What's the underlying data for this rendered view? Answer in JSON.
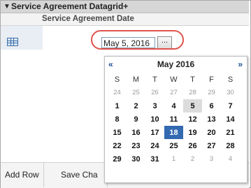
{
  "panel": {
    "title": "Service Agreement Datagrid+"
  },
  "grid": {
    "column_header": "Service Agreement Date"
  },
  "date_field": {
    "value": "May 5, 2016",
    "button_label": "..."
  },
  "toolbar": {
    "add_row": "Add Row",
    "save_changes": "Save Cha"
  },
  "calendar": {
    "prev": "«",
    "next": "»",
    "month_label": "May 2016",
    "weekdays": [
      "S",
      "M",
      "T",
      "W",
      "T",
      "F",
      "S"
    ],
    "weeks": [
      [
        {
          "d": "24",
          "m": "other"
        },
        {
          "d": "25",
          "m": "other"
        },
        {
          "d": "26",
          "m": "other"
        },
        {
          "d": "27",
          "m": "other"
        },
        {
          "d": "28",
          "m": "other"
        },
        {
          "d": "29",
          "m": "other"
        },
        {
          "d": "30",
          "m": "other"
        }
      ],
      [
        {
          "d": "1",
          "m": "cur"
        },
        {
          "d": "2",
          "m": "cur"
        },
        {
          "d": "3",
          "m": "cur"
        },
        {
          "d": "4",
          "m": "cur"
        },
        {
          "d": "5",
          "m": "hover"
        },
        {
          "d": "6",
          "m": "cur"
        },
        {
          "d": "7",
          "m": "cur"
        }
      ],
      [
        {
          "d": "8",
          "m": "cur"
        },
        {
          "d": "9",
          "m": "cur"
        },
        {
          "d": "10",
          "m": "cur"
        },
        {
          "d": "11",
          "m": "cur"
        },
        {
          "d": "12",
          "m": "cur"
        },
        {
          "d": "13",
          "m": "cur"
        },
        {
          "d": "14",
          "m": "cur"
        }
      ],
      [
        {
          "d": "15",
          "m": "cur"
        },
        {
          "d": "16",
          "m": "cur"
        },
        {
          "d": "17",
          "m": "cur"
        },
        {
          "d": "18",
          "m": "sel"
        },
        {
          "d": "19",
          "m": "cur"
        },
        {
          "d": "20",
          "m": "cur"
        },
        {
          "d": "21",
          "m": "cur"
        }
      ],
      [
        {
          "d": "22",
          "m": "cur"
        },
        {
          "d": "23",
          "m": "cur"
        },
        {
          "d": "24",
          "m": "cur"
        },
        {
          "d": "25",
          "m": "cur"
        },
        {
          "d": "26",
          "m": "cur"
        },
        {
          "d": "27",
          "m": "cur"
        },
        {
          "d": "28",
          "m": "cur"
        }
      ],
      [
        {
          "d": "29",
          "m": "cur"
        },
        {
          "d": "30",
          "m": "cur"
        },
        {
          "d": "31",
          "m": "cur"
        },
        {
          "d": "1",
          "m": "other"
        },
        {
          "d": "2",
          "m": "other"
        },
        {
          "d": "3",
          "m": "other"
        },
        {
          "d": "4",
          "m": "other"
        }
      ]
    ]
  },
  "colors": {
    "selected_day": "#3269b0",
    "highlight_ring": "#e0524b",
    "nav_arrows": "#1d4f95"
  },
  "icons": {
    "collapse": "collapse-triangle-icon",
    "row": "grid-table-icon"
  }
}
